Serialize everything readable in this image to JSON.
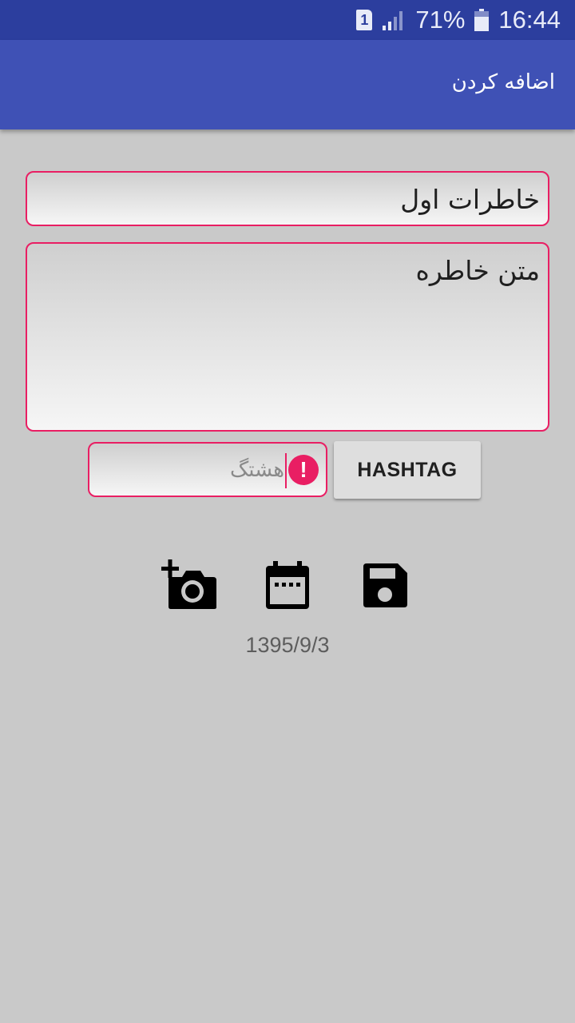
{
  "status_bar": {
    "sim_label": "1",
    "battery_text": "71%",
    "battery_level": 0.71,
    "time": "16:44"
  },
  "app_bar": {
    "title": "اضافه کردن"
  },
  "form": {
    "title_value": "خاطرات اول",
    "body_value": "متن خاطره",
    "hashtag_placeholder": "هشتگ",
    "hashtag_error_glyph": "!",
    "hashtag_button_label": "HASHTAG"
  },
  "actions": {
    "icons": [
      "add-photo-icon",
      "calendar-icon",
      "save-icon"
    ]
  },
  "date": "1395/9/3",
  "colors": {
    "status_bar": "#2c3e9e",
    "app_bar": "#3f51b5",
    "accent": "#e91e63",
    "background": "#c9c9c9"
  }
}
